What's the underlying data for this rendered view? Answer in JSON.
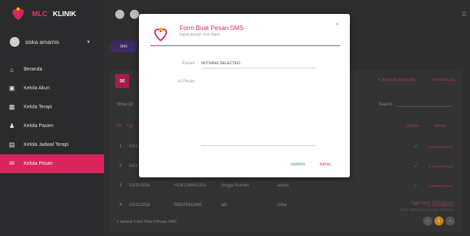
{
  "app": {
    "brand_mlc": "MLC",
    "brand_klinik": "KLINIK"
  },
  "user": {
    "name": "siska amarnis",
    "caret": "▾"
  },
  "sidebar": {
    "items": [
      {
        "label": "Beranda",
        "icon": "home-icon",
        "glyph": "⌂"
      },
      {
        "label": "Kelola Akun",
        "icon": "account-icon",
        "glyph": "▣"
      },
      {
        "label": "Kelola Terapi",
        "icon": "therapy-icon",
        "glyph": "▦"
      },
      {
        "label": "Kelola Pasien",
        "icon": "patients-icon",
        "glyph": "♟"
      },
      {
        "label": "Kelola Jadwal Terapi",
        "icon": "calendar-icon",
        "glyph": "▤"
      },
      {
        "label": "Kelola Pesan",
        "icon": "mail-icon",
        "glyph": "✉"
      }
    ]
  },
  "topbar": {
    "dots": "• • • • •",
    "menu_glyph": "☰"
  },
  "main": {
    "sms_button": "SMS",
    "buat_pesan": "✎ BUAT PESAN SMS",
    "refresh": "⟳ REFRESH",
    "show_label": "Show",
    "show_value": "10",
    "search_label": "Search:",
    "columns": {
      "no": "No",
      "tgl": "Tgl",
      "status": "Status",
      "menu": "Menu"
    },
    "rows": [
      {
        "no": "1",
        "tgl": "01/1",
        "phone": "",
        "name": "",
        "msg": "",
        "status": "ok",
        "menu": "➤ KIRIM PESAN"
      },
      {
        "no": "2",
        "tgl": "01/1",
        "phone": "",
        "name": "",
        "msg": "",
        "status": "ok",
        "menu": "➤ KIRIM PESAN"
      },
      {
        "no": "3",
        "tgl": "01/11/2018",
        "phone": "+6281266051311",
        "name": "Angga Romiko",
        "msg": "asdsd",
        "status": "ok",
        "menu": "➤ KIRIM PESAN"
      },
      {
        "no": "4",
        "tgl": "02/11/2018",
        "phone": "085376311495",
        "name": "abi",
        "msg": "coba",
        "status": "fail",
        "menu": "➤ KIRIM PESAN"
      }
    ],
    "status_glyphs": {
      "ok": "✓",
      "fail": "✕"
    },
    "footer": "1 sampai 4 dari Total 4 Pesan SMS",
    "watermark_title": "Activate Windows",
    "watermark_sub": "Go to Settings to activate Windows.",
    "pager": {
      "prev": "‹",
      "current": "1",
      "next": "›"
    }
  },
  "modal": {
    "title": "Form Buat Pesan SMS",
    "subtitle": "Input pesan sms baru",
    "close": "×",
    "pasien_label": "Pasien",
    "pasien_value": "NOTHING SELECTED",
    "isi_label": "Isi Pesan",
    "save": "SIMPAN",
    "cancel": "BATAL"
  },
  "colors": {
    "accent": "#d52a61",
    "success": "#2e9e4e",
    "sidebar": "#2b2b2d"
  }
}
